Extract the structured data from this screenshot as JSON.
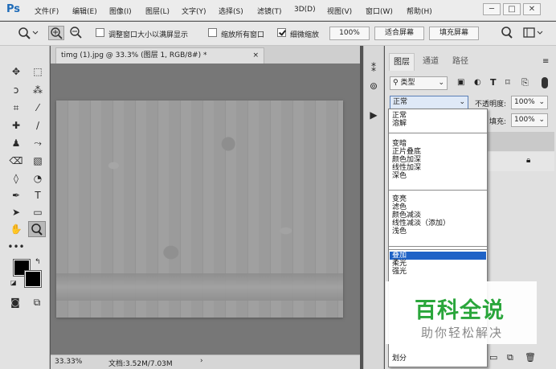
{
  "app": {
    "logo": "Ps"
  },
  "menu": [
    "文件(F)",
    "编辑(E)",
    "图像(I)",
    "图层(L)",
    "文字(Y)",
    "选择(S)",
    "滤镜(T)",
    "3D(D)",
    "视图(V)",
    "窗口(W)",
    "帮助(H)"
  ],
  "window_controls": {
    "minimize": "─",
    "restore": "□",
    "close": "✕"
  },
  "options": {
    "resize_windows_label": "调整窗口大小以满屏显示",
    "resize_windows_checked": false,
    "zoom_all_label": "缩放所有窗口",
    "zoom_all_checked": false,
    "scrubby_zoom_label": "细微缩放",
    "scrubby_zoom_checked": true,
    "zoom_percent": "100%",
    "fit_screen": "适合屏幕",
    "fill_screen": "填充屏幕"
  },
  "document": {
    "tab_title": "timg (1).jpg @ 33.3% (图层 1, RGB/8#) *",
    "tab_close": "×",
    "zoom": "33.33%",
    "doc_size": "文档:3.52M/7.03M",
    "status_arrow": "›"
  },
  "layers_panel": {
    "tabs": [
      "图层",
      "通道",
      "路径"
    ],
    "filter_label": "类型",
    "blend_mode": "正常",
    "opacity_label": "不透明度:",
    "opacity_value": "100%",
    "fill_label": "填充:",
    "fill_value": "100%"
  },
  "blend_modes": {
    "group1": [
      "正常",
      "溶解"
    ],
    "group2": [
      "变暗",
      "正片叠底",
      "颜色加深",
      "线性加深",
      "深色"
    ],
    "group3": [
      "变亮",
      "滤色",
      "颜色减淡",
      "线性减淡（添加）",
      "浅色"
    ],
    "group4": [
      "叠加",
      "柔光",
      "强光"
    ],
    "group6": [
      "划分"
    ],
    "selected": "叠加"
  },
  "watermark": {
    "title": "百科全说",
    "subtitle": "助你轻松解决"
  },
  "colors": {
    "accent": "#1f63c6",
    "watermark_green": "#2aa63b",
    "ps_blue": "#1e6bb8"
  }
}
